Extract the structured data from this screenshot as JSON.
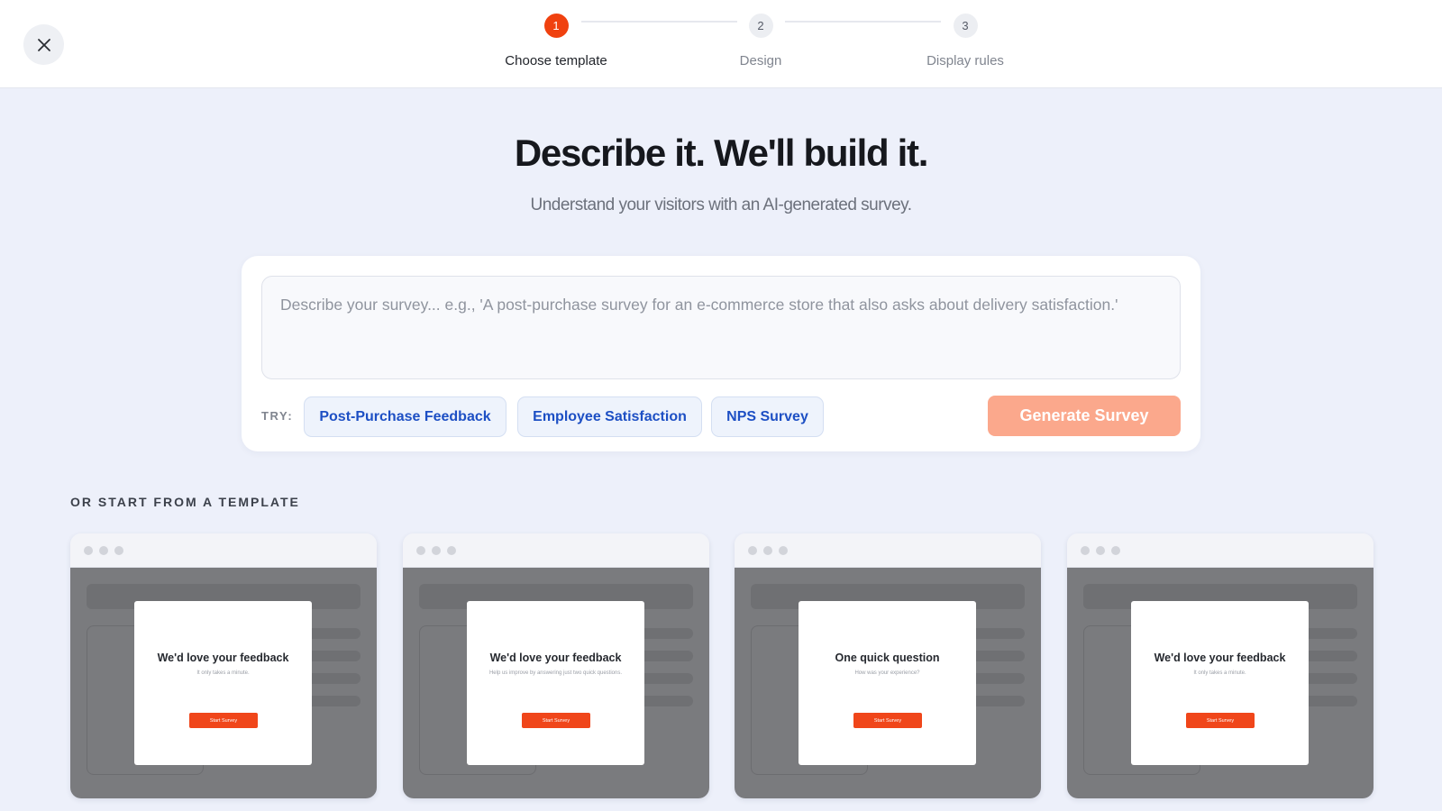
{
  "topbar": {
    "close_icon": "close-icon",
    "steps": [
      {
        "number": "1",
        "label": "Choose template",
        "active": true
      },
      {
        "number": "2",
        "label": "Design",
        "active": false
      },
      {
        "number": "3",
        "label": "Display rules",
        "active": false
      }
    ]
  },
  "hero": {
    "title": "Describe it. We'll build it.",
    "subtitle": "Understand your visitors with an AI-generated survey."
  },
  "prompt": {
    "placeholder": "Describe your survey... e.g., 'A post-purchase survey for an e-commerce store that also asks about delivery satisfaction.'",
    "value": "",
    "try_label": "TRY:",
    "chips": [
      "Post-Purchase Feedback",
      "Employee Satisfaction",
      "NPS Survey"
    ],
    "generate_label": "Generate Survey"
  },
  "templates": {
    "heading": "OR START FROM A TEMPLATE",
    "cards": [
      {
        "title": "We'd love your feedback",
        "subtitle": "It only takes a minute.",
        "button": "Start Survey"
      },
      {
        "title": "We'd love your feedback",
        "subtitle": "Help us improve by answering just two quick questions.",
        "button": "Start Survey"
      },
      {
        "title": "One quick question",
        "subtitle": "How was your experience?",
        "button": "Start Survey"
      },
      {
        "title": "We'd love your feedback",
        "subtitle": "It only takes a minute.",
        "button": "Start Survey"
      }
    ]
  },
  "colors": {
    "accent": "#f0410f",
    "accent_disabled": "#fba88c",
    "chip_text": "#1d4fc4",
    "page_bg": "#edf0fa"
  }
}
